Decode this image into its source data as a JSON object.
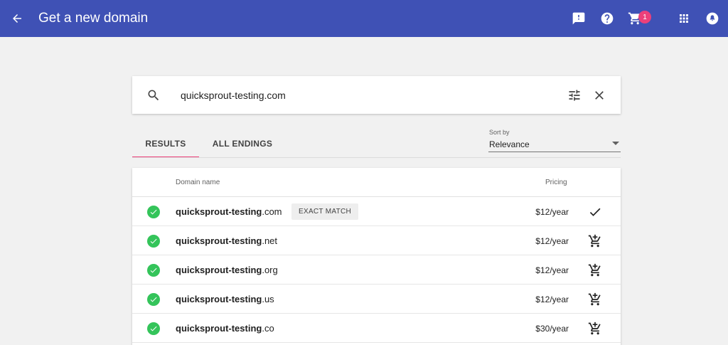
{
  "header": {
    "title": "Get a new domain",
    "cart_count": "1",
    "icons": [
      "back-arrow-icon",
      "feedback-icon",
      "help-icon",
      "cart-icon",
      "apps-grid-icon",
      "account-icon"
    ]
  },
  "search": {
    "value": "quicksprout-testing.com",
    "icons": [
      "search-icon",
      "filter-tune-icon",
      "close-icon"
    ]
  },
  "tabs": [
    {
      "label": "RESULTS",
      "active": true
    },
    {
      "label": "ALL ENDINGS",
      "active": false
    }
  ],
  "sort": {
    "label": "Sort by",
    "value": "Relevance"
  },
  "table": {
    "col_domain": "Domain name",
    "col_pricing": "Pricing",
    "rows": [
      {
        "base": "quicksprout-testing",
        "tld": ".com",
        "badge": "EXACT MATCH",
        "price": "$12/year",
        "action": "check-icon"
      },
      {
        "base": "quicksprout-testing",
        "tld": ".net",
        "badge": "",
        "price": "$12/year",
        "action": "add-to-cart-icon"
      },
      {
        "base": "quicksprout-testing",
        "tld": ".org",
        "badge": "",
        "price": "$12/year",
        "action": "add-to-cart-icon"
      },
      {
        "base": "quicksprout-testing",
        "tld": ".us",
        "badge": "",
        "price": "$12/year",
        "action": "add-to-cart-icon"
      },
      {
        "base": "quicksprout-testing",
        "tld": ".co",
        "badge": "",
        "price": "$30/year",
        "action": "add-to-cart-icon"
      }
    ]
  },
  "colors": {
    "header_bg": "#3f51b5",
    "badge": "#ec407a",
    "available": "#34c45a",
    "tab_indicator": "#ec407a"
  }
}
